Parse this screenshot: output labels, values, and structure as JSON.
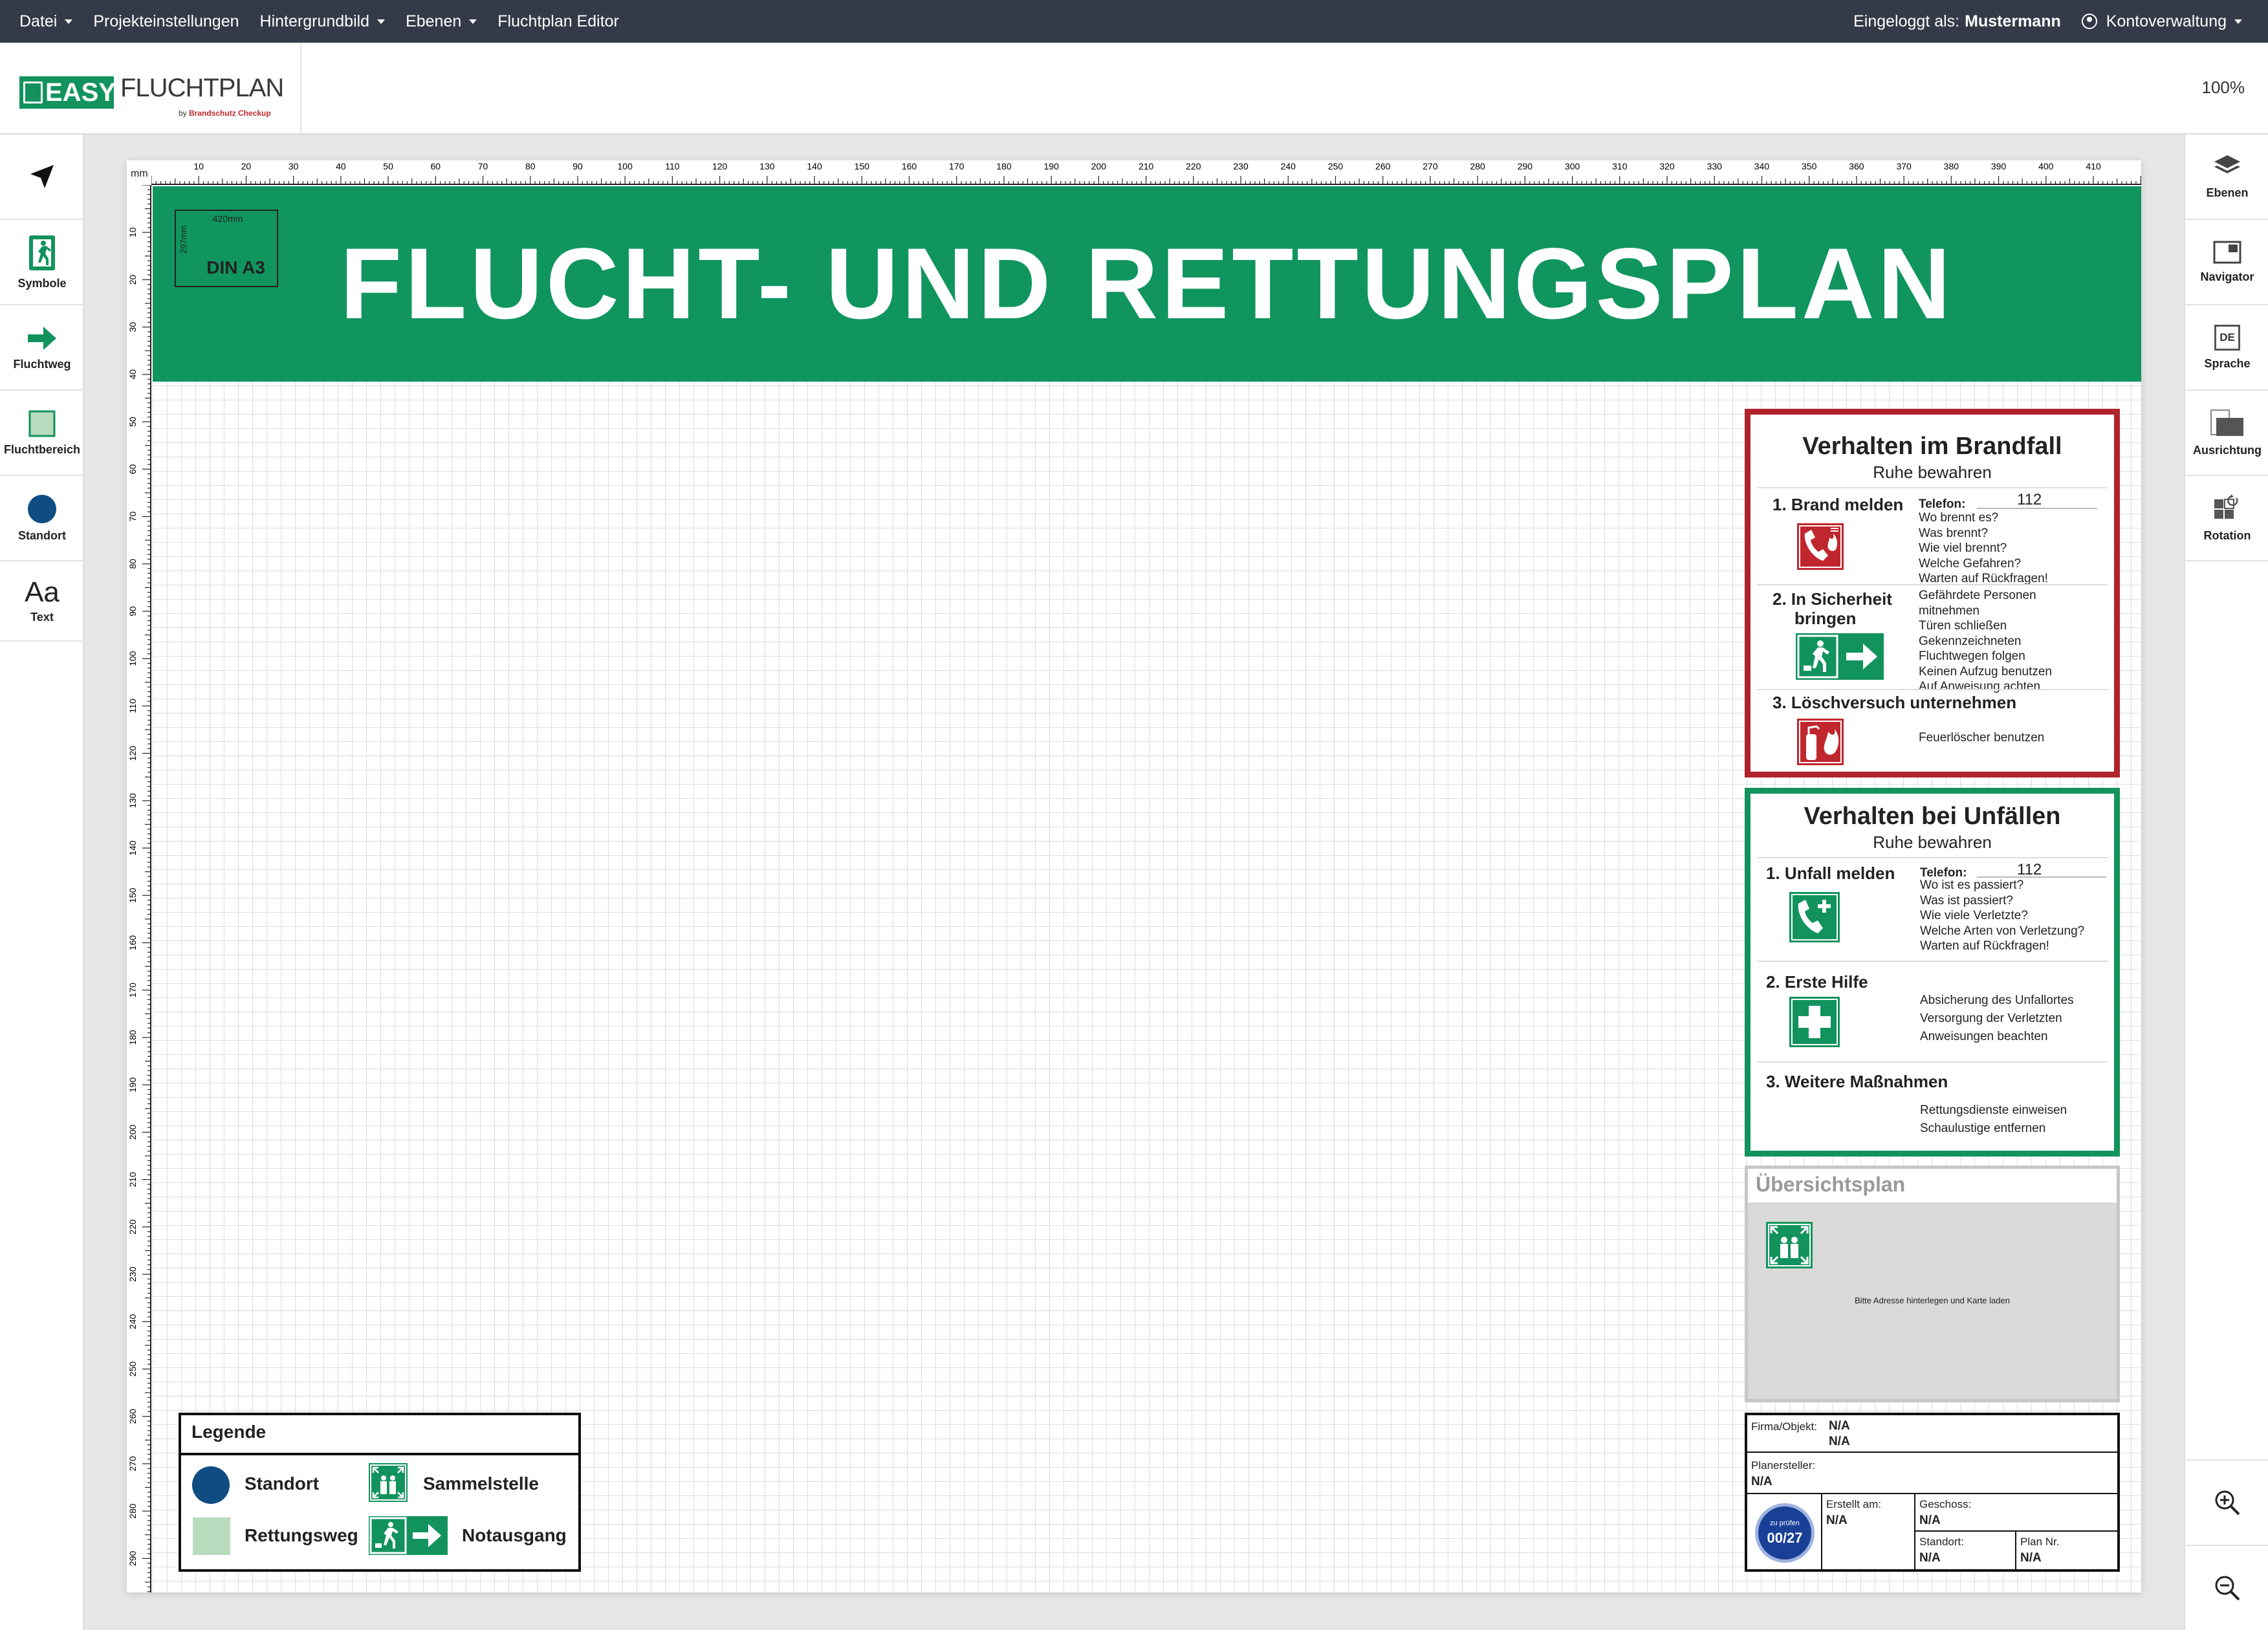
{
  "menu": {
    "items": [
      {
        "label": "Datei",
        "dropdown": true
      },
      {
        "label": "Projekteinstellungen",
        "dropdown": false
      },
      {
        "label": "Hintergrundbild",
        "dropdown": true
      },
      {
        "label": "Ebenen",
        "dropdown": true
      },
      {
        "label": "Fluchtplan Editor",
        "dropdown": false
      }
    ],
    "logged_in_label": "Eingeloggt als:",
    "user": "Mustermann",
    "account": "Kontoverwaltung"
  },
  "logo": {
    "easy": "EASY",
    "name": "FLUCHTPLAN",
    "by": "by",
    "brand": "Brandschutz Checkup"
  },
  "zoom": "100%",
  "left_tools": [
    {
      "label": "",
      "icon": "pointer-icon"
    },
    {
      "label": "Symbole",
      "icon": "emergency-exit-icon"
    },
    {
      "label": "Fluchtweg",
      "icon": "arrow-right-icon"
    },
    {
      "label": "Fluchtbereich",
      "icon": "square-icon"
    },
    {
      "label": "Standort",
      "icon": "circle-icon"
    },
    {
      "label": "Text",
      "icon": "text-icon",
      "glyph": "Aa"
    }
  ],
  "right_tools": [
    {
      "label": "Ebenen",
      "icon": "layers-icon"
    },
    {
      "label": "Navigator",
      "icon": "navigator-icon"
    },
    {
      "label": "Sprache",
      "icon": "language-icon",
      "glyph": "DE"
    },
    {
      "label": "Ausrichtung",
      "icon": "orientation-icon"
    },
    {
      "label": "Rotation",
      "icon": "rotation-icon"
    }
  ],
  "ruler": {
    "unit": "mm",
    "top_labels": [
      10,
      20,
      30,
      40,
      50,
      60,
      70,
      80,
      90,
      100,
      110,
      120,
      130,
      140,
      150,
      160,
      170,
      180,
      190,
      200,
      210,
      220,
      230,
      240,
      250,
      260,
      270,
      280,
      290,
      300,
      310,
      320,
      330,
      340,
      350,
      360,
      370,
      380,
      390,
      400,
      410
    ],
    "left_labels": [
      10,
      20,
      30,
      40,
      50,
      60,
      70,
      80,
      90,
      100,
      110,
      120,
      130,
      140,
      150,
      160,
      170,
      180,
      190,
      200,
      210,
      220,
      230,
      240,
      250,
      260,
      270,
      280,
      290
    ]
  },
  "plan": {
    "title": "FLUCHT- UND RETTUNGSPLAN",
    "din": {
      "width": "420mm",
      "height": "297mm",
      "format": "DIN A3"
    }
  },
  "fire": {
    "title": "Verhalten im Brandfall",
    "subtitle": "Ruhe bewahren",
    "steps": [
      {
        "num": "1.",
        "label": "Brand melden"
      },
      {
        "num": "2.",
        "label": "In Sicherheit bringen",
        "line1": "In Sicherheit",
        "line2": "bringen"
      },
      {
        "num": "3.",
        "label": "Löschversuch unternehmen"
      }
    ],
    "telefon_label": "Telefon:",
    "telefon": "112",
    "s1_lines": [
      "Wo brennt es?",
      "Was brennt?",
      "Wie viel brennt?",
      "Welche Gefahren?",
      "Warten auf Rückfragen!"
    ],
    "s2_lines": [
      "Gefährdete Personen",
      "mitnehmen",
      "Türen schließen",
      "Gekennzeichneten",
      "Fluchtwegen folgen",
      "Keinen Aufzug benutzen",
      "Auf Anweisung achten"
    ],
    "s3_lines": [
      "Feuerlöscher benutzen"
    ],
    "color": "#b0232b"
  },
  "accident": {
    "title": "Verhalten bei Unfällen",
    "subtitle": "Ruhe bewahren",
    "steps": [
      {
        "num": "1.",
        "label": "Unfall melden"
      },
      {
        "num": "2.",
        "label": "Erste Hilfe"
      },
      {
        "num": "3.",
        "label": "Weitere Maßnahmen"
      }
    ],
    "telefon_label": "Telefon:",
    "telefon": "112",
    "s1_lines": [
      "Wo ist es passiert?",
      "Was ist passiert?",
      "Wie viele Verletzte?",
      "Welche Arten von Verletzung?",
      "Warten auf Rückfragen!"
    ],
    "s2_lines": [
      "Absicherung des Unfallortes",
      "Versorgung der Verletzten",
      "Anweisungen beachten"
    ],
    "s3_lines": [
      "Rettungsdienste einweisen",
      "Schaulustige entfernen"
    ],
    "color": "#12935d"
  },
  "overview": {
    "title": "Übersichtsplan",
    "note": "Bitte Adresse hinterlegen und Karte laden"
  },
  "titleblock": {
    "firma_label": "Firma/Objekt:",
    "firma_val1": "N/A",
    "firma_val2": "N/A",
    "planer_label": "Planersteller:",
    "planer_val": "N/A",
    "erstellt_label": "Erstellt am:",
    "erstellt_val": "N/A",
    "geschoss_label": "Geschoss:",
    "geschoss_val": "N/A",
    "standort_label": "Standort:",
    "standort_val": "N/A",
    "plannr_label": "Plan Nr.",
    "plannr_val": "N/A",
    "stamp_top": "zu prüfen",
    "stamp_date": "00/27"
  },
  "legend": {
    "title": "Legende",
    "items": [
      {
        "label": "Standort",
        "icon": "location-dot-icon"
      },
      {
        "label": "Sammelstelle",
        "icon": "assembly-point-icon"
      },
      {
        "label": "Rettungsweg",
        "icon": "escape-route-swatch-icon"
      },
      {
        "label": "Notausgang",
        "icon": "emergency-exit-sign-icon"
      }
    ]
  },
  "colors": {
    "green": "#12935d",
    "red": "#b0232b",
    "topbar": "#343a47",
    "standort": "#0f4c81",
    "route": "#b9dbbd"
  }
}
